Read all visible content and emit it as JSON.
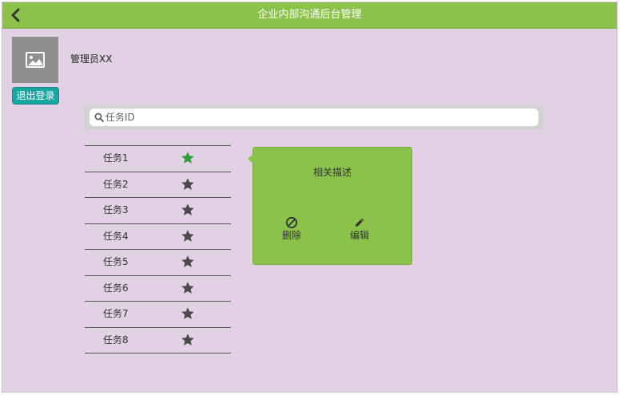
{
  "header": {
    "title": "企业内部沟通后台管理",
    "back_icon": "chevron-left-icon"
  },
  "user": {
    "name": "管理员XX",
    "avatar_icon": "image-icon",
    "logout_label": "退出登录"
  },
  "search": {
    "placeholder": "任务ID",
    "value": "",
    "icon": "search-icon"
  },
  "tasks": [
    {
      "label": "任务1",
      "starred": true
    },
    {
      "label": "任务2",
      "starred": false
    },
    {
      "label": "任务3",
      "starred": false
    },
    {
      "label": "任务4",
      "starred": false
    },
    {
      "label": "任务5",
      "starred": false
    },
    {
      "label": "任务6",
      "starred": false
    },
    {
      "label": "任务7",
      "starred": false
    },
    {
      "label": "任务8",
      "starred": false
    }
  ],
  "detail": {
    "description": "相关描述",
    "delete_label": "删除",
    "edit_label": "编辑"
  },
  "colors": {
    "header_bg": "#8bc34a",
    "page_bg": "#e2d1e4",
    "logout_bg": "#1aa6a0",
    "star_active": "#2e9e3a",
    "star_default": "#4a4a4a",
    "panel_bg": "#8bc34a"
  }
}
